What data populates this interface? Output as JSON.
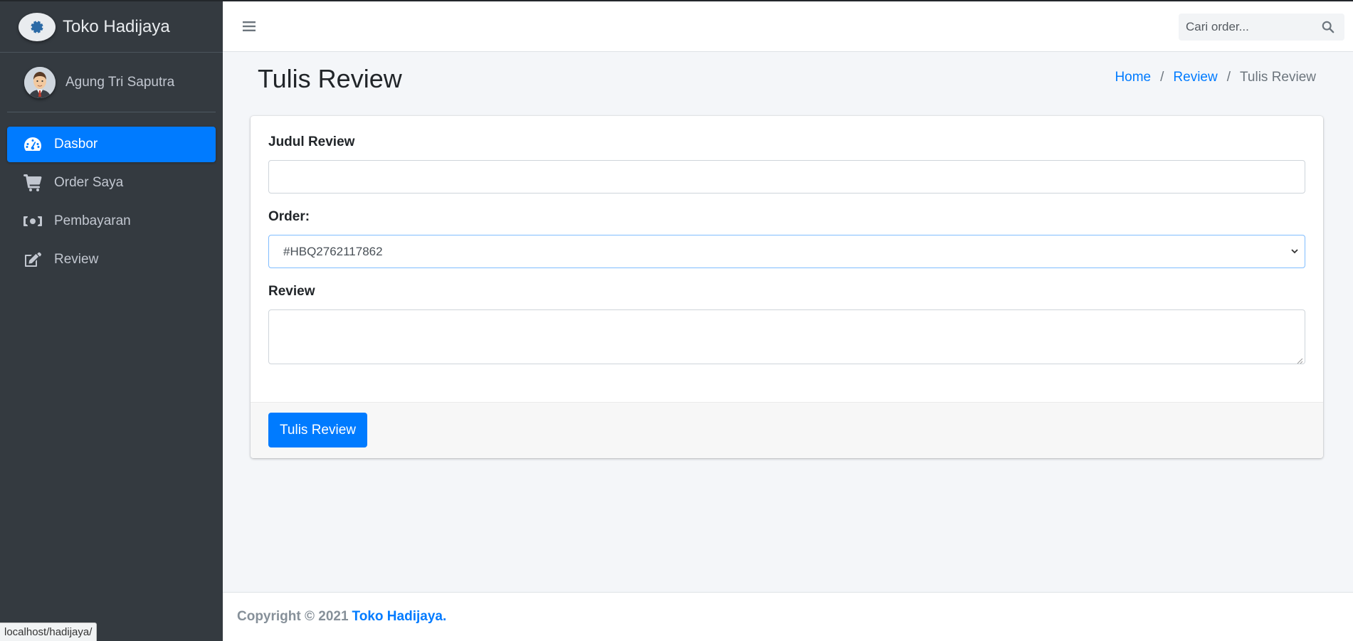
{
  "brand": {
    "name": "Toko Hadijaya",
    "logo_icon": "gear-icon"
  },
  "user": {
    "name": "Agung Tri Saputra",
    "avatar_icon": "user-avatar"
  },
  "sidebar": {
    "items": [
      {
        "label": "Dasbor",
        "icon": "tachometer-icon",
        "active": true
      },
      {
        "label": "Order Saya",
        "icon": "cart-icon",
        "active": false
      },
      {
        "label": "Pembayaran",
        "icon": "money-bill-icon",
        "active": false
      },
      {
        "label": "Review",
        "icon": "edit-icon",
        "active": false
      }
    ]
  },
  "topbar": {
    "menu_icon": "hamburger-icon",
    "search": {
      "placeholder": "Cari order...",
      "value": "",
      "icon": "search-icon"
    }
  },
  "page": {
    "title": "Tulis Review",
    "breadcrumb": {
      "home": "Home",
      "parent": "Review",
      "current": "Tulis Review",
      "separator": "/"
    }
  },
  "form": {
    "title_label": "Judul Review",
    "title_value": "",
    "order_label": "Order:",
    "order_selected": "#HBQ2762117862",
    "review_label": "Review",
    "review_value": "",
    "submit_label": "Tulis Review"
  },
  "footer": {
    "copyright": "Copyright © 2021",
    "brand": "Toko Hadijaya",
    "suffix": "."
  },
  "statusbar": {
    "url": "localhost/hadijaya/"
  },
  "colors": {
    "primary": "#007bff",
    "sidebar": "#343a40",
    "content_bg": "#f4f6f9"
  }
}
